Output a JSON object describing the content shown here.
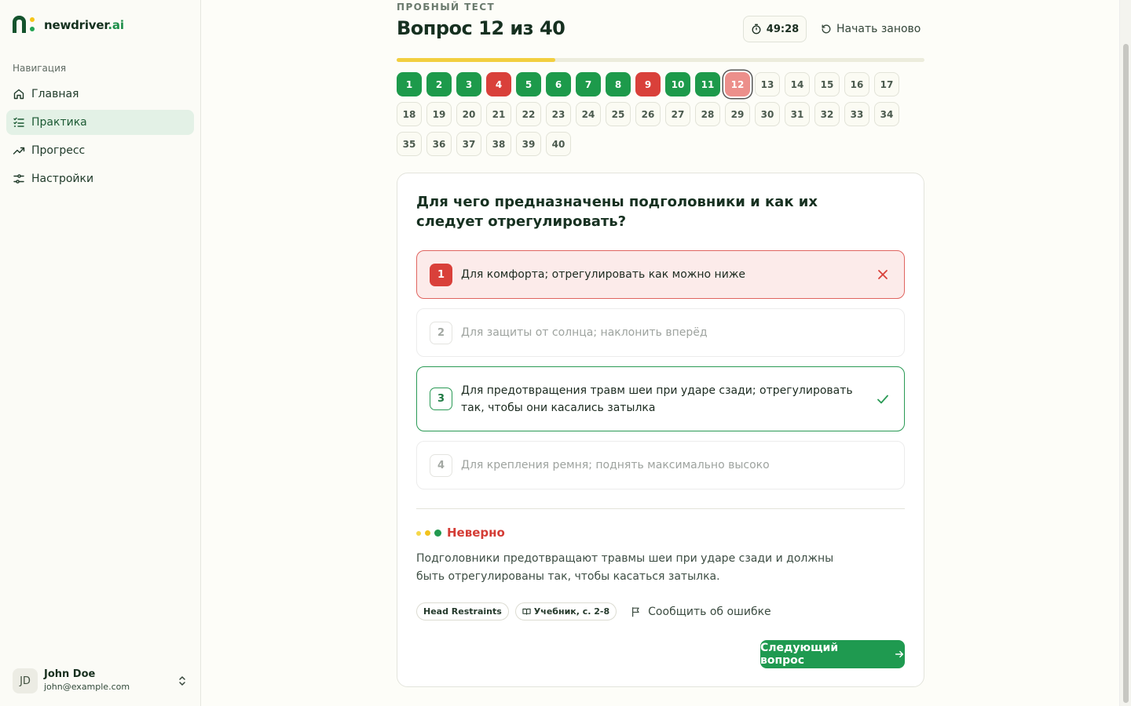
{
  "brand": {
    "name_main": "newdriver",
    "name_suffix": ".ai"
  },
  "sidebar": {
    "nav_title": "Навигация",
    "items": [
      {
        "label": "Главная",
        "icon": "home-icon",
        "active": false
      },
      {
        "label": "Практика",
        "icon": "list-check-icon",
        "active": true
      },
      {
        "label": "Прогресс",
        "icon": "trending-up-icon",
        "active": false
      },
      {
        "label": "Настройки",
        "icon": "sliders-icon",
        "active": false
      }
    ],
    "user": {
      "initials": "JD",
      "name": "John Doe",
      "email": "john@example.com"
    }
  },
  "header": {
    "kicker": "ПРОБНЫЙ ТЕСТ",
    "title": "Вопрос 12 из 40",
    "timer": "49:28",
    "restart_label": "Начать заново",
    "progress": 0.3
  },
  "question_grid": {
    "current": 12,
    "statuses": [
      "ok",
      "ok",
      "ok",
      "bad",
      "ok",
      "ok",
      "ok",
      "ok",
      "bad",
      "ok",
      "ok",
      "cur",
      "empty",
      "empty",
      "empty",
      "empty",
      "empty",
      "empty",
      "empty",
      "empty",
      "empty",
      "empty",
      "empty",
      "empty",
      "empty",
      "empty",
      "empty",
      "empty",
      "empty",
      "empty",
      "empty",
      "empty",
      "empty",
      "empty",
      "empty",
      "empty",
      "empty",
      "empty",
      "empty",
      "empty"
    ],
    "labels": [
      "1",
      "2",
      "3",
      "4",
      "5",
      "6",
      "7",
      "8",
      "9",
      "10",
      "11",
      "12",
      "13",
      "14",
      "15",
      "16",
      "17",
      "18",
      "19",
      "20",
      "21",
      "22",
      "23",
      "24",
      "25",
      "26",
      "27",
      "28",
      "29",
      "30",
      "31",
      "32",
      "33",
      "34",
      "35",
      "36",
      "37",
      "38",
      "39",
      "40"
    ]
  },
  "card": {
    "question": "Для чего предназначены подголовники и как их следует отрегулировать?",
    "options": [
      {
        "num": "1",
        "text": "Для комфорта; отрегулировать как можно ниже",
        "state": "wrong"
      },
      {
        "num": "2",
        "text": "Для защиты от солнца; наклонить вперёд",
        "state": "neutral"
      },
      {
        "num": "3",
        "text": "Для предотвращения травм шеи при ударе сзади; отрегулировать так, чтобы они касались затылка",
        "state": "right"
      },
      {
        "num": "4",
        "text": "Для крепления ремня; поднять максимально высоко",
        "state": "neutral"
      }
    ],
    "verdict": "Неверно",
    "explanation": "Подголовники предотвращают травмы шеи при ударе сзади и должны быть отрегулированы так, чтобы касаться затылка.",
    "tags": [
      "Head Restraints",
      "Учебник, с. 2-8"
    ],
    "report_label": "Сообщить об ошибке",
    "next_label": "Следующий вопрос"
  },
  "colors": {
    "accent": "#1f9a50",
    "error": "#d9403a",
    "progress": "#f2cf3f"
  }
}
